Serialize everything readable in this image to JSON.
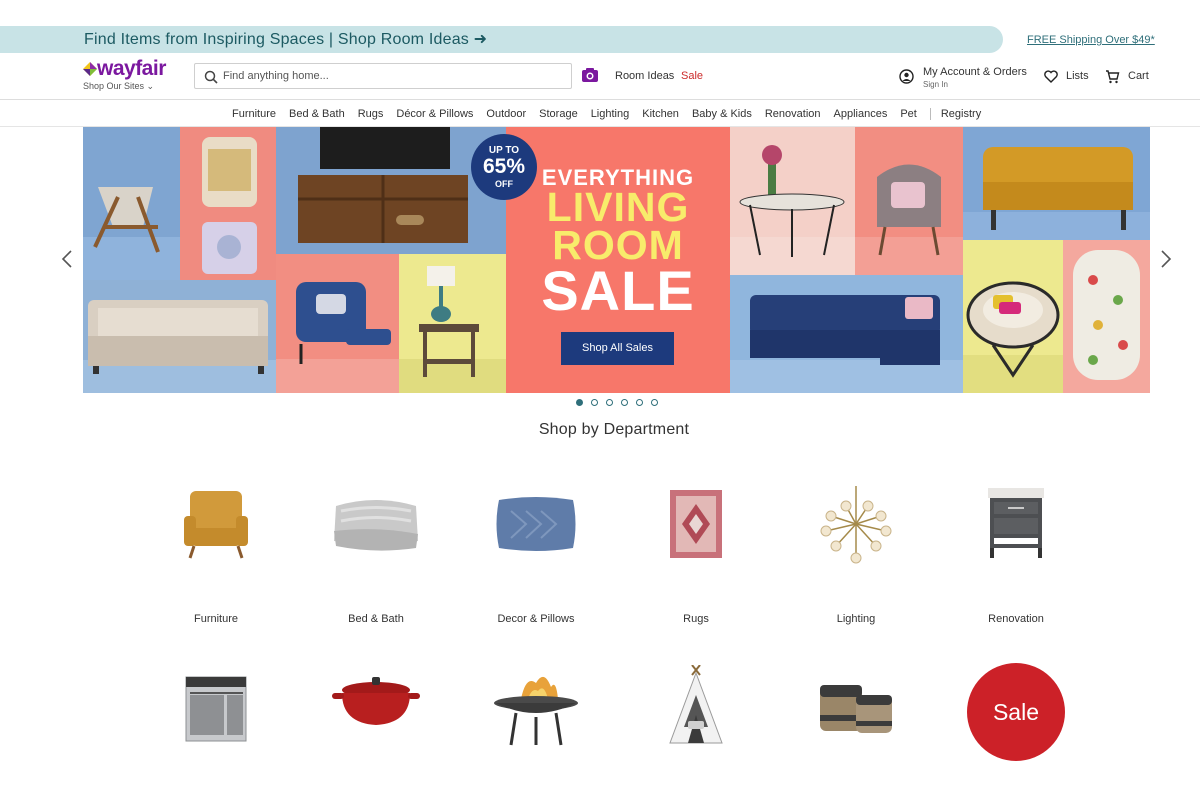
{
  "promo": {
    "text": "Find Items from Inspiring Spaces | Shop Room Ideas ➜",
    "free_shipping": "FREE Shipping Over $49*"
  },
  "header": {
    "logo_text": "wayfair",
    "shop_sites": "Shop Our Sites ⌄",
    "search_placeholder": "Find anything home...",
    "room_ideas": "Room Ideas",
    "sale": "Sale",
    "account_line1": "My Account & Orders",
    "account_line2": "Sign In",
    "lists": "Lists",
    "cart": "Cart"
  },
  "nav": {
    "items": [
      "Furniture",
      "Bed & Bath",
      "Rugs",
      "Décor & Pillows",
      "Outdoor",
      "Storage",
      "Lighting",
      "Kitchen",
      "Baby & Kids",
      "Renovation",
      "Appliances",
      "Pet",
      "Registry"
    ]
  },
  "hero": {
    "badge_l1": "UP TO",
    "badge_l2": "65%",
    "badge_l3": "OFF",
    "line1": "EVERYTHING",
    "line2": "LIVING",
    "line3": "ROOM",
    "line4": "SALE",
    "cta": "Shop All Sales",
    "slide_count": 6,
    "active_slide": 1
  },
  "departments": {
    "title": "Shop by Department",
    "items": [
      {
        "label": "Furniture",
        "icon": "armchair-icon"
      },
      {
        "label": "Bed & Bath",
        "icon": "blanket-icon"
      },
      {
        "label": "Decor & Pillows",
        "icon": "pillow-icon"
      },
      {
        "label": "Rugs",
        "icon": "rug-icon"
      },
      {
        "label": "Lighting",
        "icon": "chandelier-icon"
      },
      {
        "label": "Renovation",
        "icon": "vanity-icon"
      },
      {
        "label": "",
        "icon": "range-oven-icon"
      },
      {
        "label": "",
        "icon": "dutch-oven-icon"
      },
      {
        "label": "",
        "icon": "fire-pit-icon"
      },
      {
        "label": "",
        "icon": "teepee-icon"
      },
      {
        "label": "",
        "icon": "baskets-icon"
      }
    ],
    "sale_circle": "Sale"
  },
  "colors": {
    "brand_purple": "#7b189f",
    "promo_bg": "#c8e3e6",
    "hero_coral": "#f7776a",
    "hero_yellow": "#f8ec6b",
    "navy": "#1d3a7d",
    "sale_red": "#cc2128"
  }
}
